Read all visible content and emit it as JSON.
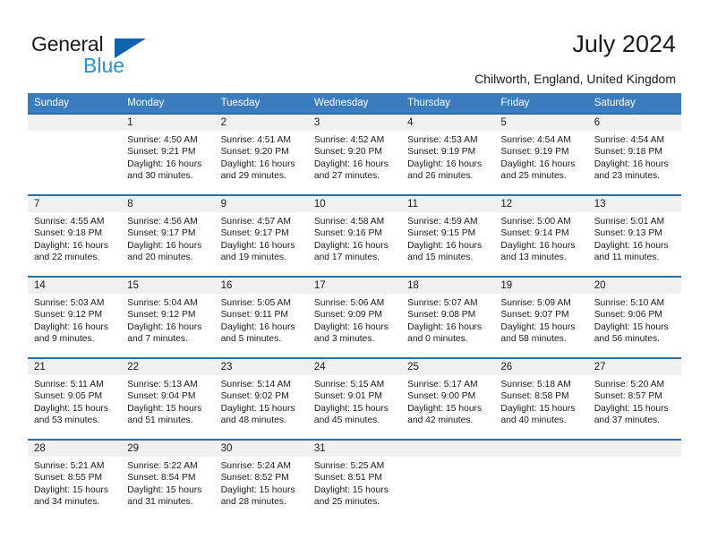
{
  "brand": {
    "name_part1": "General",
    "name_part2": "Blue",
    "triangle_color": "#1263ad",
    "blue_text_color": "#2a8fd4"
  },
  "header": {
    "title": "July 2024",
    "location": "Chilworth, England, United Kingdom"
  },
  "theme": {
    "header_blue": "#3a7cbe",
    "rule_blue": "#2e6da4",
    "daynum_band": "#f0f0f0"
  },
  "weekday_headers": [
    "Sunday",
    "Monday",
    "Tuesday",
    "Wednesday",
    "Thursday",
    "Friday",
    "Saturday"
  ],
  "labels": {
    "sunrise_prefix": "Sunrise: ",
    "sunset_prefix": "Sunset: ",
    "daylight_prefix": "Daylight: "
  },
  "weeks": [
    [
      {
        "day": "",
        "sunrise": "",
        "sunset": "",
        "daylight_line1": "",
        "daylight_line2": ""
      },
      {
        "day": "1",
        "sunrise": "Sunrise: 4:50 AM",
        "sunset": "Sunset: 9:21 PM",
        "daylight_line1": "Daylight: 16 hours",
        "daylight_line2": "and 30 minutes."
      },
      {
        "day": "2",
        "sunrise": "Sunrise: 4:51 AM",
        "sunset": "Sunset: 9:20 PM",
        "daylight_line1": "Daylight: 16 hours",
        "daylight_line2": "and 29 minutes."
      },
      {
        "day": "3",
        "sunrise": "Sunrise: 4:52 AM",
        "sunset": "Sunset: 9:20 PM",
        "daylight_line1": "Daylight: 16 hours",
        "daylight_line2": "and 27 minutes."
      },
      {
        "day": "4",
        "sunrise": "Sunrise: 4:53 AM",
        "sunset": "Sunset: 9:19 PM",
        "daylight_line1": "Daylight: 16 hours",
        "daylight_line2": "and 26 minutes."
      },
      {
        "day": "5",
        "sunrise": "Sunrise: 4:54 AM",
        "sunset": "Sunset: 9:19 PM",
        "daylight_line1": "Daylight: 16 hours",
        "daylight_line2": "and 25 minutes."
      },
      {
        "day": "6",
        "sunrise": "Sunrise: 4:54 AM",
        "sunset": "Sunset: 9:18 PM",
        "daylight_line1": "Daylight: 16 hours",
        "daylight_line2": "and 23 minutes."
      }
    ],
    [
      {
        "day": "7",
        "sunrise": "Sunrise: 4:55 AM",
        "sunset": "Sunset: 9:18 PM",
        "daylight_line1": "Daylight: 16 hours",
        "daylight_line2": "and 22 minutes."
      },
      {
        "day": "8",
        "sunrise": "Sunrise: 4:56 AM",
        "sunset": "Sunset: 9:17 PM",
        "daylight_line1": "Daylight: 16 hours",
        "daylight_line2": "and 20 minutes."
      },
      {
        "day": "9",
        "sunrise": "Sunrise: 4:57 AM",
        "sunset": "Sunset: 9:17 PM",
        "daylight_line1": "Daylight: 16 hours",
        "daylight_line2": "and 19 minutes."
      },
      {
        "day": "10",
        "sunrise": "Sunrise: 4:58 AM",
        "sunset": "Sunset: 9:16 PM",
        "daylight_line1": "Daylight: 16 hours",
        "daylight_line2": "and 17 minutes."
      },
      {
        "day": "11",
        "sunrise": "Sunrise: 4:59 AM",
        "sunset": "Sunset: 9:15 PM",
        "daylight_line1": "Daylight: 16 hours",
        "daylight_line2": "and 15 minutes."
      },
      {
        "day": "12",
        "sunrise": "Sunrise: 5:00 AM",
        "sunset": "Sunset: 9:14 PM",
        "daylight_line1": "Daylight: 16 hours",
        "daylight_line2": "and 13 minutes."
      },
      {
        "day": "13",
        "sunrise": "Sunrise: 5:01 AM",
        "sunset": "Sunset: 9:13 PM",
        "daylight_line1": "Daylight: 16 hours",
        "daylight_line2": "and 11 minutes."
      }
    ],
    [
      {
        "day": "14",
        "sunrise": "Sunrise: 5:03 AM",
        "sunset": "Sunset: 9:12 PM",
        "daylight_line1": "Daylight: 16 hours",
        "daylight_line2": "and 9 minutes."
      },
      {
        "day": "15",
        "sunrise": "Sunrise: 5:04 AM",
        "sunset": "Sunset: 9:12 PM",
        "daylight_line1": "Daylight: 16 hours",
        "daylight_line2": "and 7 minutes."
      },
      {
        "day": "16",
        "sunrise": "Sunrise: 5:05 AM",
        "sunset": "Sunset: 9:11 PM",
        "daylight_line1": "Daylight: 16 hours",
        "daylight_line2": "and 5 minutes."
      },
      {
        "day": "17",
        "sunrise": "Sunrise: 5:06 AM",
        "sunset": "Sunset: 9:09 PM",
        "daylight_line1": "Daylight: 16 hours",
        "daylight_line2": "and 3 minutes."
      },
      {
        "day": "18",
        "sunrise": "Sunrise: 5:07 AM",
        "sunset": "Sunset: 9:08 PM",
        "daylight_line1": "Daylight: 16 hours",
        "daylight_line2": "and 0 minutes."
      },
      {
        "day": "19",
        "sunrise": "Sunrise: 5:09 AM",
        "sunset": "Sunset: 9:07 PM",
        "daylight_line1": "Daylight: 15 hours",
        "daylight_line2": "and 58 minutes."
      },
      {
        "day": "20",
        "sunrise": "Sunrise: 5:10 AM",
        "sunset": "Sunset: 9:06 PM",
        "daylight_line1": "Daylight: 15 hours",
        "daylight_line2": "and 56 minutes."
      }
    ],
    [
      {
        "day": "21",
        "sunrise": "Sunrise: 5:11 AM",
        "sunset": "Sunset: 9:05 PM",
        "daylight_line1": "Daylight: 15 hours",
        "daylight_line2": "and 53 minutes."
      },
      {
        "day": "22",
        "sunrise": "Sunrise: 5:13 AM",
        "sunset": "Sunset: 9:04 PM",
        "daylight_line1": "Daylight: 15 hours",
        "daylight_line2": "and 51 minutes."
      },
      {
        "day": "23",
        "sunrise": "Sunrise: 5:14 AM",
        "sunset": "Sunset: 9:02 PM",
        "daylight_line1": "Daylight: 15 hours",
        "daylight_line2": "and 48 minutes."
      },
      {
        "day": "24",
        "sunrise": "Sunrise: 5:15 AM",
        "sunset": "Sunset: 9:01 PM",
        "daylight_line1": "Daylight: 15 hours",
        "daylight_line2": "and 45 minutes."
      },
      {
        "day": "25",
        "sunrise": "Sunrise: 5:17 AM",
        "sunset": "Sunset: 9:00 PM",
        "daylight_line1": "Daylight: 15 hours",
        "daylight_line2": "and 42 minutes."
      },
      {
        "day": "26",
        "sunrise": "Sunrise: 5:18 AM",
        "sunset": "Sunset: 8:58 PM",
        "daylight_line1": "Daylight: 15 hours",
        "daylight_line2": "and 40 minutes."
      },
      {
        "day": "27",
        "sunrise": "Sunrise: 5:20 AM",
        "sunset": "Sunset: 8:57 PM",
        "daylight_line1": "Daylight: 15 hours",
        "daylight_line2": "and 37 minutes."
      }
    ],
    [
      {
        "day": "28",
        "sunrise": "Sunrise: 5:21 AM",
        "sunset": "Sunset: 8:55 PM",
        "daylight_line1": "Daylight: 15 hours",
        "daylight_line2": "and 34 minutes."
      },
      {
        "day": "29",
        "sunrise": "Sunrise: 5:22 AM",
        "sunset": "Sunset: 8:54 PM",
        "daylight_line1": "Daylight: 15 hours",
        "daylight_line2": "and 31 minutes."
      },
      {
        "day": "30",
        "sunrise": "Sunrise: 5:24 AM",
        "sunset": "Sunset: 8:52 PM",
        "daylight_line1": "Daylight: 15 hours",
        "daylight_line2": "and 28 minutes."
      },
      {
        "day": "31",
        "sunrise": "Sunrise: 5:25 AM",
        "sunset": "Sunset: 8:51 PM",
        "daylight_line1": "Daylight: 15 hours",
        "daylight_line2": "and 25 minutes."
      },
      {
        "day": "",
        "sunrise": "",
        "sunset": "",
        "daylight_line1": "",
        "daylight_line2": ""
      },
      {
        "day": "",
        "sunrise": "",
        "sunset": "",
        "daylight_line1": "",
        "daylight_line2": ""
      },
      {
        "day": "",
        "sunrise": "",
        "sunset": "",
        "daylight_line1": "",
        "daylight_line2": ""
      }
    ]
  ]
}
